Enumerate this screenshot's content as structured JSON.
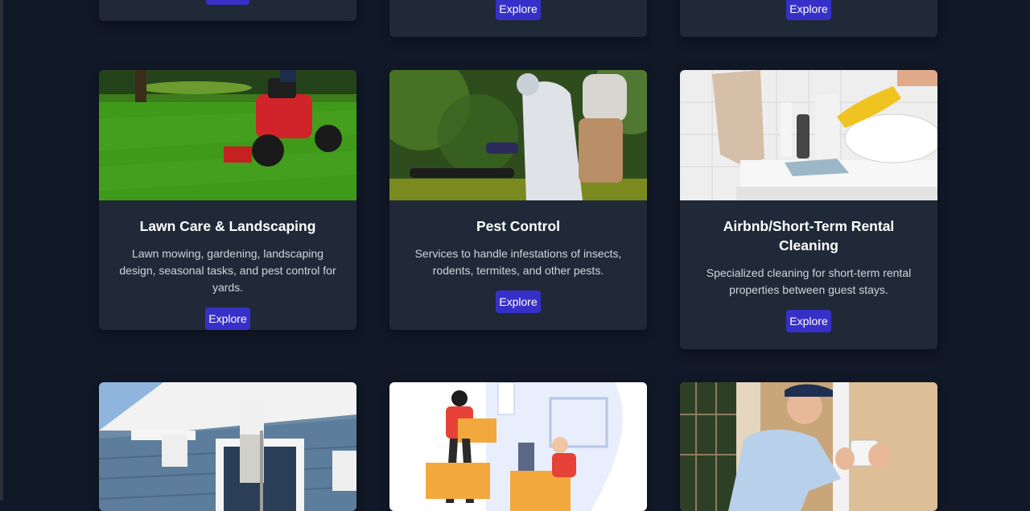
{
  "colors": {
    "background": "#111827",
    "card": "#1f2937",
    "button": "#3730c8"
  },
  "top_row": [
    {
      "button_label": "Explore"
    },
    {
      "button_label": "Explore"
    },
    {
      "button_label": "Explore"
    }
  ],
  "services": [
    {
      "title": "Lawn Care & Landscaping",
      "description": "Lawn mowing, gardening, landscaping design, seasonal tasks, and pest control for yards.",
      "button_label": "Explore",
      "image": "lawn-mower-photo"
    },
    {
      "title": "Pest Control",
      "description": "Services to handle infestations of insects, rodents, termites, and other pests.",
      "button_label": "Explore",
      "image": "pest-sprayer-photo"
    },
    {
      "title": "Airbnb/Short-Term Rental Cleaning",
      "description": "Specialized cleaning for short-term rental properties between guest stays.",
      "button_label": "Explore",
      "image": "bathroom-cleaning-photo"
    }
  ],
  "bottom_row": [
    {
      "image": "house-painters-photo"
    },
    {
      "image": "movers-illustration"
    },
    {
      "image": "alarm-installer-photo"
    }
  ]
}
